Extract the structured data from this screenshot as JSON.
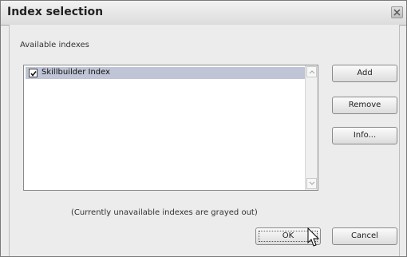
{
  "window": {
    "title": "Index selection",
    "close_icon": "close-icon"
  },
  "list": {
    "label": "Available indexes",
    "items": [
      {
        "label": "Skillbuilder Index",
        "checked": true
      }
    ]
  },
  "buttons": {
    "add": "Add",
    "remove": "Remove",
    "info": "Info...",
    "ok": "OK",
    "cancel": "Cancel"
  },
  "note": "(Currently unavailable indexes are grayed out)"
}
